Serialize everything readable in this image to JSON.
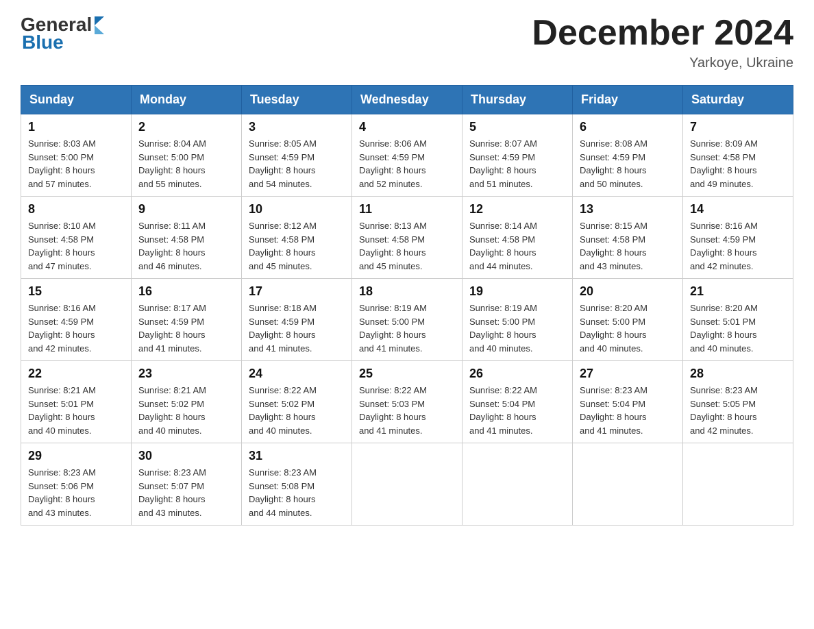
{
  "header": {
    "logo": {
      "general": "General",
      "blue": "Blue"
    },
    "title": "December 2024",
    "location": "Yarkoye, Ukraine"
  },
  "calendar": {
    "days_of_week": [
      "Sunday",
      "Monday",
      "Tuesday",
      "Wednesday",
      "Thursday",
      "Friday",
      "Saturday"
    ],
    "weeks": [
      [
        {
          "day": "1",
          "sunrise": "8:03 AM",
          "sunset": "5:00 PM",
          "daylight": "8 hours and 57 minutes."
        },
        {
          "day": "2",
          "sunrise": "8:04 AM",
          "sunset": "5:00 PM",
          "daylight": "8 hours and 55 minutes."
        },
        {
          "day": "3",
          "sunrise": "8:05 AM",
          "sunset": "4:59 PM",
          "daylight": "8 hours and 54 minutes."
        },
        {
          "day": "4",
          "sunrise": "8:06 AM",
          "sunset": "4:59 PM",
          "daylight": "8 hours and 52 minutes."
        },
        {
          "day": "5",
          "sunrise": "8:07 AM",
          "sunset": "4:59 PM",
          "daylight": "8 hours and 51 minutes."
        },
        {
          "day": "6",
          "sunrise": "8:08 AM",
          "sunset": "4:59 PM",
          "daylight": "8 hours and 50 minutes."
        },
        {
          "day": "7",
          "sunrise": "8:09 AM",
          "sunset": "4:58 PM",
          "daylight": "8 hours and 49 minutes."
        }
      ],
      [
        {
          "day": "8",
          "sunrise": "8:10 AM",
          "sunset": "4:58 PM",
          "daylight": "8 hours and 47 minutes."
        },
        {
          "day": "9",
          "sunrise": "8:11 AM",
          "sunset": "4:58 PM",
          "daylight": "8 hours and 46 minutes."
        },
        {
          "day": "10",
          "sunrise": "8:12 AM",
          "sunset": "4:58 PM",
          "daylight": "8 hours and 45 minutes."
        },
        {
          "day": "11",
          "sunrise": "8:13 AM",
          "sunset": "4:58 PM",
          "daylight": "8 hours and 45 minutes."
        },
        {
          "day": "12",
          "sunrise": "8:14 AM",
          "sunset": "4:58 PM",
          "daylight": "8 hours and 44 minutes."
        },
        {
          "day": "13",
          "sunrise": "8:15 AM",
          "sunset": "4:58 PM",
          "daylight": "8 hours and 43 minutes."
        },
        {
          "day": "14",
          "sunrise": "8:16 AM",
          "sunset": "4:59 PM",
          "daylight": "8 hours and 42 minutes."
        }
      ],
      [
        {
          "day": "15",
          "sunrise": "8:16 AM",
          "sunset": "4:59 PM",
          "daylight": "8 hours and 42 minutes."
        },
        {
          "day": "16",
          "sunrise": "8:17 AM",
          "sunset": "4:59 PM",
          "daylight": "8 hours and 41 minutes."
        },
        {
          "day": "17",
          "sunrise": "8:18 AM",
          "sunset": "4:59 PM",
          "daylight": "8 hours and 41 minutes."
        },
        {
          "day": "18",
          "sunrise": "8:19 AM",
          "sunset": "5:00 PM",
          "daylight": "8 hours and 41 minutes."
        },
        {
          "day": "19",
          "sunrise": "8:19 AM",
          "sunset": "5:00 PM",
          "daylight": "8 hours and 40 minutes."
        },
        {
          "day": "20",
          "sunrise": "8:20 AM",
          "sunset": "5:00 PM",
          "daylight": "8 hours and 40 minutes."
        },
        {
          "day": "21",
          "sunrise": "8:20 AM",
          "sunset": "5:01 PM",
          "daylight": "8 hours and 40 minutes."
        }
      ],
      [
        {
          "day": "22",
          "sunrise": "8:21 AM",
          "sunset": "5:01 PM",
          "daylight": "8 hours and 40 minutes."
        },
        {
          "day": "23",
          "sunrise": "8:21 AM",
          "sunset": "5:02 PM",
          "daylight": "8 hours and 40 minutes."
        },
        {
          "day": "24",
          "sunrise": "8:22 AM",
          "sunset": "5:02 PM",
          "daylight": "8 hours and 40 minutes."
        },
        {
          "day": "25",
          "sunrise": "8:22 AM",
          "sunset": "5:03 PM",
          "daylight": "8 hours and 41 minutes."
        },
        {
          "day": "26",
          "sunrise": "8:22 AM",
          "sunset": "5:04 PM",
          "daylight": "8 hours and 41 minutes."
        },
        {
          "day": "27",
          "sunrise": "8:23 AM",
          "sunset": "5:04 PM",
          "daylight": "8 hours and 41 minutes."
        },
        {
          "day": "28",
          "sunrise": "8:23 AM",
          "sunset": "5:05 PM",
          "daylight": "8 hours and 42 minutes."
        }
      ],
      [
        {
          "day": "29",
          "sunrise": "8:23 AM",
          "sunset": "5:06 PM",
          "daylight": "8 hours and 43 minutes."
        },
        {
          "day": "30",
          "sunrise": "8:23 AM",
          "sunset": "5:07 PM",
          "daylight": "8 hours and 43 minutes."
        },
        {
          "day": "31",
          "sunrise": "8:23 AM",
          "sunset": "5:08 PM",
          "daylight": "8 hours and 44 minutes."
        },
        null,
        null,
        null,
        null
      ]
    ],
    "labels": {
      "sunrise": "Sunrise:",
      "sunset": "Sunset:",
      "daylight": "Daylight:"
    }
  }
}
